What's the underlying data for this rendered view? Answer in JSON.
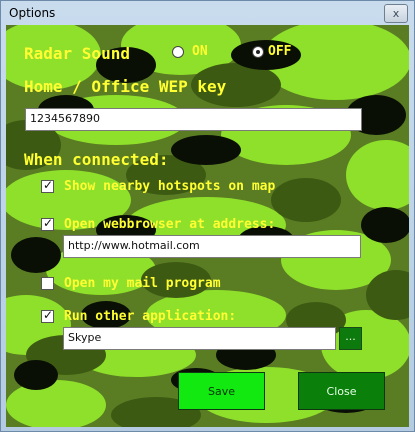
{
  "window": {
    "title": "Options",
    "close_glyph": "x"
  },
  "radar": {
    "label": "Radar Sound",
    "on_label": "ON",
    "off_label": "OFF",
    "selected": "OFF"
  },
  "wep": {
    "label": "Home / Office WEP key",
    "value": "1234567890"
  },
  "connected": {
    "heading": "When connected:",
    "show_hotspots": {
      "label": "Show nearby hotspots on map",
      "checked": true
    },
    "open_browser": {
      "label": "Open webbrowser at address:",
      "checked": true,
      "value": "http://www.hotmail.com"
    },
    "open_mail": {
      "label": "Open my mail program",
      "checked": false
    },
    "run_app": {
      "label": "Run other application:",
      "checked": true,
      "value": "Skype",
      "browse_label": "..."
    }
  },
  "buttons": {
    "save_label": "Save",
    "close_label": "Close"
  },
  "colors": {
    "label_yellow": "#ffff33",
    "save_green": "#11e911",
    "close_green": "#0a7f0a",
    "camo_light": "#8ee02a",
    "camo_dark": "#0a0f06"
  },
  "icons": {
    "check": "check-icon",
    "close": "close-icon"
  }
}
